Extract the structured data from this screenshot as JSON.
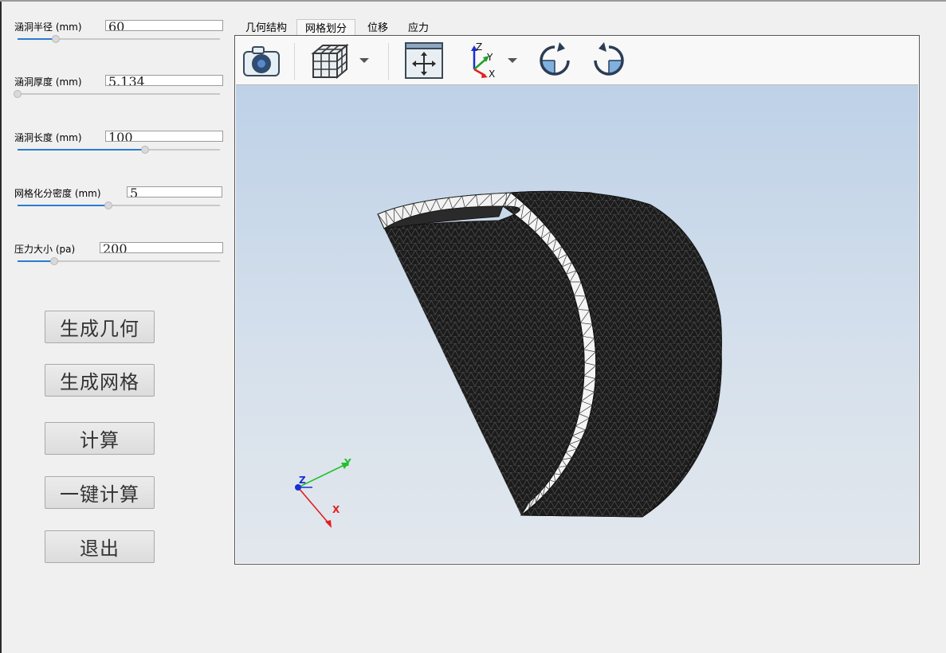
{
  "params": [
    {
      "label": "涵洞半径 (mm)",
      "value": "60",
      "slider_fraction": 0.19
    },
    {
      "label": "涵洞厚度 (mm)",
      "value": "5.134",
      "slider_fraction": 0.0
    },
    {
      "label": "涵洞长度 (mm)",
      "value": "100",
      "slider_fraction": 0.63
    },
    {
      "label": "网格化分密度 (mm)",
      "value": "5",
      "slider_fraction": 0.45
    },
    {
      "label": "压力大小 (pa)",
      "value": "200",
      "slider_fraction": 0.18
    }
  ],
  "buttons": {
    "generate_geometry": "生成几何",
    "generate_mesh": "生成网格",
    "compute": "计算",
    "one_click_compute": "一键计算",
    "exit": "退出"
  },
  "tabs": [
    "几何结构",
    "网格划分",
    "位移",
    "应力"
  ],
  "active_tab": "网格划分",
  "toolbar": {
    "icons": [
      "camera-icon",
      "mesh-cube-icon",
      "dropdown-arrow-icon",
      "fit-view-icon",
      "axes-icon",
      "dropdown-arrow-icon",
      "rotate-cw-icon",
      "rotate-ccw-icon"
    ],
    "axes_labels": [
      "Z",
      "Y",
      "X"
    ]
  },
  "triad": {
    "x": "X",
    "y": "Y",
    "z": "Z"
  },
  "colors": {
    "x_axis": "#e02020",
    "y_axis": "#22c02a",
    "z_axis": "#1a2fd0",
    "accent": "#2b7bd3",
    "mesh": "#1c1c1c"
  }
}
